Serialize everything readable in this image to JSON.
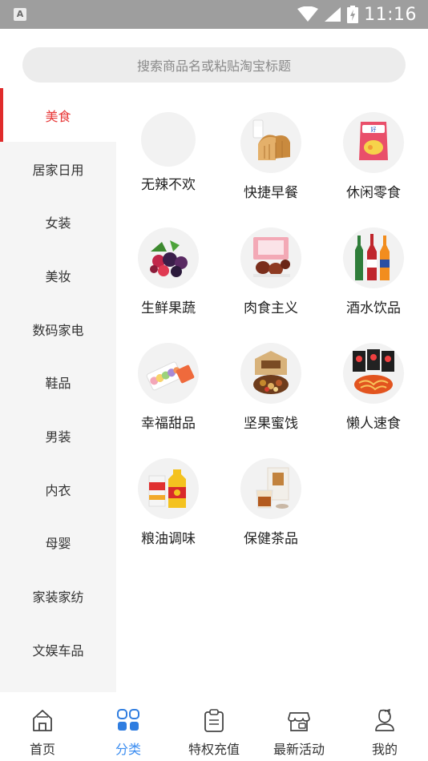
{
  "status_bar": {
    "time": "11:16",
    "app_badge": "A"
  },
  "search": {
    "placeholder": "搜索商品名或粘贴淘宝标题"
  },
  "sidebar": {
    "active_index": 0,
    "items": [
      {
        "label": "美食"
      },
      {
        "label": "居家日用"
      },
      {
        "label": "女装"
      },
      {
        "label": "美妆"
      },
      {
        "label": "数码家电"
      },
      {
        "label": "鞋品"
      },
      {
        "label": "男装"
      },
      {
        "label": "内衣"
      },
      {
        "label": "母婴"
      },
      {
        "label": "家装家纺"
      },
      {
        "label": "文娱车品"
      }
    ]
  },
  "categories": [
    {
      "label": "无辣不欢",
      "icon": "empty-placeholder"
    },
    {
      "label": "快捷早餐",
      "icon": "bread-milk-icon"
    },
    {
      "label": "休闲零食",
      "icon": "chips-bag-icon"
    },
    {
      "label": "生鲜果蔬",
      "icon": "berries-icon"
    },
    {
      "label": "肉食主义",
      "icon": "meat-box-icon"
    },
    {
      "label": "酒水饮品",
      "icon": "bottles-icon"
    },
    {
      "label": "幸福甜品",
      "icon": "macaron-icon"
    },
    {
      "label": "坚果蜜饯",
      "icon": "nuts-box-icon"
    },
    {
      "label": "懒人速食",
      "icon": "instant-noodles-icon"
    },
    {
      "label": "粮油调味",
      "icon": "oil-rice-icon"
    },
    {
      "label": "保健茶品",
      "icon": "tea-box-icon"
    }
  ],
  "bottom_nav": {
    "active_index": 1,
    "items": [
      {
        "label": "首页",
        "icon": "home-icon"
      },
      {
        "label": "分类",
        "icon": "category-grid-icon"
      },
      {
        "label": "特权充值",
        "icon": "clipboard-icon"
      },
      {
        "label": "最新活动",
        "icon": "shop-icon"
      },
      {
        "label": "我的",
        "icon": "profile-icon"
      }
    ]
  },
  "colors": {
    "accent_red": "#e02b2b",
    "nav_active_blue": "#3a8cf0"
  }
}
